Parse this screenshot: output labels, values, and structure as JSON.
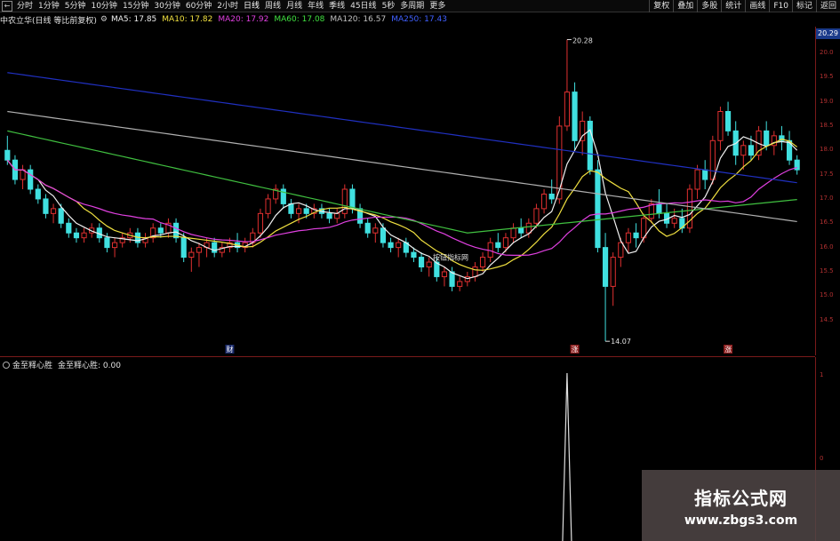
{
  "toolbar": {
    "left_items": [
      "分时",
      "1分钟",
      "5分钟",
      "10分钟",
      "15分钟",
      "30分钟",
      "60分钟",
      "2小时",
      "日线",
      "周线",
      "月线",
      "年线",
      "季线",
      "45日线",
      "5秒",
      "多周期",
      "更多"
    ],
    "active_item": "日线",
    "right_items": [
      "复权",
      "叠加",
      "多股",
      "统计",
      "画线",
      "F10",
      "标记",
      "返回"
    ]
  },
  "ma_line": {
    "stock_label": "中农立华(日线 等比前复权)",
    "items": [
      {
        "label": "MA5: 17.85",
        "color": "#f0f0f0"
      },
      {
        "label": "MA10: 17.82",
        "color": "#f0e040"
      },
      {
        "label": "MA20: 17.92",
        "color": "#e040e0"
      },
      {
        "label": "MA60: 17.08",
        "color": "#40e040"
      },
      {
        "label": "MA120: 16.57",
        "color": "#c0c0c0"
      },
      {
        "label": "MA250: 17.43",
        "color": "#4060ff"
      }
    ]
  },
  "price_axis": {
    "current_price": "20.29",
    "ticks": [
      "20.0",
      "19.5",
      "19.0",
      "18.5",
      "18.0",
      "17.5",
      "17.0",
      "16.5",
      "16.0",
      "15.5",
      "15.0",
      "14.5"
    ]
  },
  "annotations": {
    "high_label": "20.28",
    "low_label": "14.07",
    "marker_text": "按钮指标网",
    "badges": [
      "财",
      "涨",
      "涨"
    ]
  },
  "sub_header": {
    "name": "金至释心胜",
    "value_text": "金至释心胜: 0.00"
  },
  "sub_axis": {
    "ticks": [
      "1",
      "0"
    ]
  },
  "watermark": {
    "title": "指标公式网",
    "url": "www.zbgs3.com"
  },
  "chart_data": {
    "type": "candlestick",
    "ylim": [
      14.0,
      20.4
    ],
    "candles": [
      [
        18.0,
        18.3,
        17.7,
        17.8
      ],
      [
        17.8,
        17.9,
        17.3,
        17.4
      ],
      [
        17.4,
        17.7,
        17.2,
        17.6
      ],
      [
        17.6,
        17.7,
        17.1,
        17.2
      ],
      [
        17.2,
        17.3,
        16.9,
        17.0
      ],
      [
        17.0,
        17.1,
        16.6,
        16.7
      ],
      [
        16.7,
        16.9,
        16.5,
        16.8
      ],
      [
        16.8,
        16.9,
        16.4,
        16.5
      ],
      [
        16.5,
        16.6,
        16.2,
        16.3
      ],
      [
        16.3,
        16.4,
        16.1,
        16.2
      ],
      [
        16.2,
        16.4,
        16.1,
        16.3
      ],
      [
        16.3,
        16.5,
        16.2,
        16.4
      ],
      [
        16.4,
        16.5,
        16.1,
        16.2
      ],
      [
        16.2,
        16.3,
        15.9,
        16.0
      ],
      [
        16.0,
        16.2,
        15.8,
        16.1
      ],
      [
        16.1,
        16.3,
        16.0,
        16.2
      ],
      [
        16.2,
        16.4,
        16.1,
        16.3
      ],
      [
        16.3,
        16.4,
        16.0,
        16.1
      ],
      [
        16.1,
        16.3,
        16.0,
        16.2
      ],
      [
        16.2,
        16.5,
        16.1,
        16.4
      ],
      [
        16.4,
        16.5,
        16.2,
        16.3
      ],
      [
        16.3,
        16.6,
        16.2,
        16.5
      ],
      [
        16.5,
        16.6,
        16.1,
        16.2
      ],
      [
        16.2,
        16.3,
        15.7,
        15.8
      ],
      [
        15.8,
        16.0,
        15.5,
        15.9
      ],
      [
        15.9,
        16.1,
        15.6,
        16.0
      ],
      [
        16.0,
        16.2,
        15.8,
        16.1
      ],
      [
        16.1,
        16.2,
        15.8,
        15.9
      ],
      [
        15.9,
        16.1,
        15.8,
        16.0
      ],
      [
        16.0,
        16.2,
        15.9,
        16.1
      ],
      [
        16.1,
        16.3,
        15.9,
        16.0
      ],
      [
        16.0,
        16.2,
        15.9,
        16.1
      ],
      [
        16.1,
        16.4,
        16.0,
        16.3
      ],
      [
        16.3,
        16.8,
        16.2,
        16.7
      ],
      [
        16.7,
        17.1,
        16.6,
        17.0
      ],
      [
        17.0,
        17.3,
        16.9,
        17.2
      ],
      [
        17.2,
        17.3,
        16.8,
        16.9
      ],
      [
        16.9,
        17.0,
        16.6,
        16.7
      ],
      [
        16.7,
        16.9,
        16.5,
        16.8
      ],
      [
        16.8,
        16.9,
        16.6,
        16.7
      ],
      [
        16.7,
        16.9,
        16.6,
        16.8
      ],
      [
        16.8,
        16.9,
        16.6,
        16.7
      ],
      [
        16.7,
        16.8,
        16.5,
        16.6
      ],
      [
        16.6,
        16.8,
        16.5,
        16.7
      ],
      [
        16.7,
        17.3,
        16.6,
        17.2
      ],
      [
        17.2,
        17.3,
        16.7,
        16.8
      ],
      [
        16.8,
        16.9,
        16.4,
        16.5
      ],
      [
        16.5,
        16.6,
        16.2,
        16.3
      ],
      [
        16.3,
        16.5,
        16.1,
        16.4
      ],
      [
        16.4,
        16.5,
        16.0,
        16.1
      ],
      [
        16.1,
        16.2,
        15.9,
        16.0
      ],
      [
        16.0,
        16.2,
        15.8,
        16.1
      ],
      [
        16.1,
        16.2,
        15.8,
        15.9
      ],
      [
        15.9,
        16.0,
        15.7,
        15.8
      ],
      [
        15.8,
        15.9,
        15.5,
        15.6
      ],
      [
        15.6,
        15.8,
        15.4,
        15.7
      ],
      [
        15.7,
        15.8,
        15.3,
        15.4
      ],
      [
        15.4,
        15.6,
        15.2,
        15.5
      ],
      [
        15.5,
        15.6,
        15.1,
        15.2
      ],
      [
        15.2,
        15.4,
        15.1,
        15.3
      ],
      [
        15.3,
        15.5,
        15.2,
        15.4
      ],
      [
        15.4,
        15.7,
        15.3,
        15.6
      ],
      [
        15.6,
        15.9,
        15.5,
        15.8
      ],
      [
        15.8,
        16.2,
        15.7,
        16.1
      ],
      [
        16.1,
        16.3,
        15.9,
        16.0
      ],
      [
        16.0,
        16.3,
        15.9,
        16.2
      ],
      [
        16.2,
        16.5,
        16.1,
        16.4
      ],
      [
        16.4,
        16.6,
        16.2,
        16.3
      ],
      [
        16.3,
        16.6,
        16.2,
        16.5
      ],
      [
        16.5,
        16.9,
        16.4,
        16.8
      ],
      [
        16.8,
        17.2,
        16.7,
        17.1
      ],
      [
        17.1,
        17.4,
        16.9,
        17.0
      ],
      [
        17.0,
        18.7,
        16.9,
        18.5
      ],
      [
        18.5,
        20.28,
        18.4,
        19.2
      ],
      [
        19.2,
        19.4,
        18.0,
        18.2
      ],
      [
        18.2,
        18.8,
        17.9,
        18.6
      ],
      [
        18.6,
        18.7,
        17.5,
        17.6
      ],
      [
        17.6,
        17.8,
        15.9,
        16.0
      ],
      [
        16.0,
        16.3,
        14.07,
        15.2
      ],
      [
        15.2,
        15.9,
        14.8,
        15.8
      ],
      [
        15.8,
        16.2,
        15.6,
        16.1
      ],
      [
        16.1,
        16.4,
        15.9,
        16.3
      ],
      [
        16.3,
        16.5,
        16.0,
        16.2
      ],
      [
        16.2,
        16.7,
        16.1,
        16.6
      ],
      [
        16.6,
        17.0,
        16.5,
        16.9
      ],
      [
        16.9,
        17.2,
        16.6,
        16.7
      ],
      [
        16.7,
        16.9,
        16.4,
        16.5
      ],
      [
        16.5,
        16.8,
        16.4,
        16.6
      ],
      [
        16.6,
        16.8,
        16.3,
        16.4
      ],
      [
        16.4,
        17.3,
        16.3,
        17.2
      ],
      [
        17.2,
        17.7,
        17.0,
        17.6
      ],
      [
        17.6,
        17.8,
        17.2,
        17.4
      ],
      [
        17.4,
        18.3,
        17.3,
        18.2
      ],
      [
        18.2,
        18.9,
        18.0,
        18.8
      ],
      [
        18.8,
        19.0,
        18.3,
        18.4
      ],
      [
        18.4,
        18.6,
        17.7,
        17.9
      ],
      [
        17.9,
        18.2,
        17.6,
        18.1
      ],
      [
        18.1,
        18.3,
        17.8,
        17.9
      ],
      [
        17.9,
        18.5,
        17.8,
        18.4
      ],
      [
        18.4,
        18.6,
        18.0,
        18.1
      ],
      [
        18.1,
        18.4,
        17.9,
        18.3
      ],
      [
        18.3,
        18.5,
        18.0,
        18.2
      ],
      [
        18.2,
        18.4,
        17.7,
        17.8
      ],
      [
        17.8,
        17.9,
        17.5,
        17.6
      ]
    ],
    "subchart": {
      "type": "line",
      "values_note": "spike to 1 at high bar, otherwise 0"
    }
  }
}
